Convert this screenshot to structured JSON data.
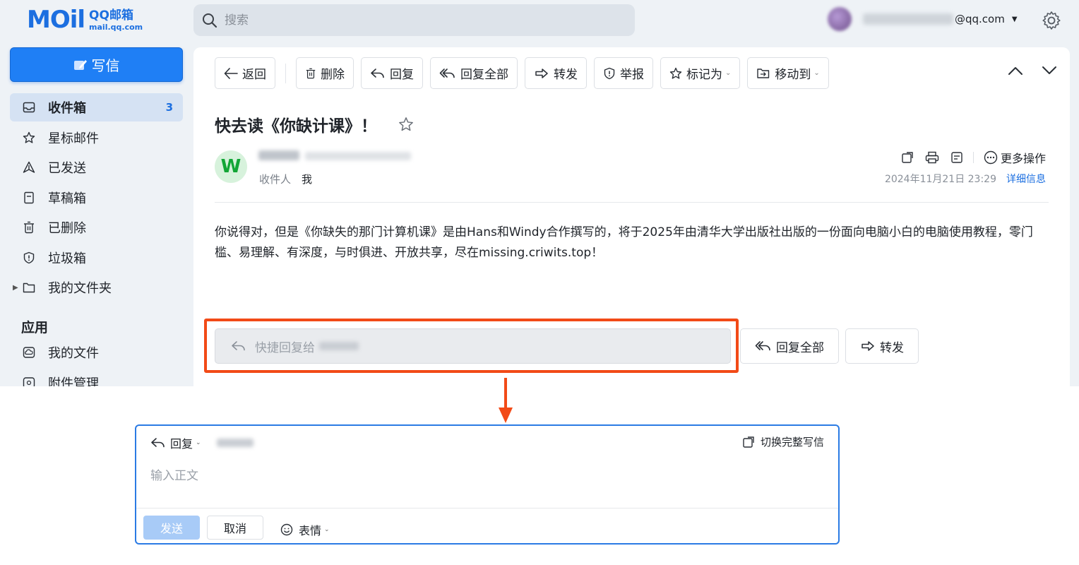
{
  "logo": {
    "main": "MOil",
    "name": "QQ邮箱",
    "url": "mail.qq.com"
  },
  "search": {
    "placeholder": "搜索"
  },
  "user": {
    "domain": "@qq.com"
  },
  "sidebar": {
    "compose": "写信",
    "items": [
      {
        "label": "收件箱",
        "count": "3",
        "icon": "inbox-icon"
      },
      {
        "label": "星标邮件",
        "icon": "star-icon"
      },
      {
        "label": "已发送",
        "icon": "sent-icon"
      },
      {
        "label": "草稿箱",
        "icon": "draft-icon"
      },
      {
        "label": "已删除",
        "icon": "trash-icon"
      },
      {
        "label": "垃圾箱",
        "icon": "shield-icon"
      },
      {
        "label": "我的文件夹",
        "icon": "folder-icon"
      }
    ],
    "apps_title": "应用",
    "apps": [
      {
        "label": "我的文件",
        "icon": "cloud-file-icon"
      },
      {
        "label": "附件管理",
        "icon": "attachment-icon"
      }
    ]
  },
  "toolbar": {
    "back": "返回",
    "delete": "删除",
    "reply": "回复",
    "reply_all": "回复全部",
    "forward": "转发",
    "report": "举报",
    "mark_as": "标记为",
    "move_to": "移动到"
  },
  "mail": {
    "subject": "快去读《你缺计课》！",
    "avatar_letter": "W",
    "recipient_label": "收件人",
    "recipient": "我",
    "more_actions": "更多操作",
    "date": "2024年11月21日 23:29",
    "detail_link": "详细信息",
    "body": "你说得对，但是《你缺失的那门计算机课》是由Hans和Windy合作撰写的，将于2025年由清华大学出版社出版的一份面向电脑小白的电脑使用教程，零门槛、易理解、有深度，与时俱进、开放共享，尽在missing.criwits.top！"
  },
  "quick_reply": {
    "placeholder": "快捷回复给",
    "reply_all": "回复全部",
    "forward": "转发"
  },
  "composer": {
    "mode": "回复",
    "switch_full": "切换完整写信",
    "body_placeholder": "输入正文",
    "send": "发送",
    "cancel": "取消",
    "emoji": "表情"
  },
  "colors": {
    "accent": "#1f7ff5",
    "highlight_border": "#f24a17",
    "avatar_green": "#12a636"
  }
}
